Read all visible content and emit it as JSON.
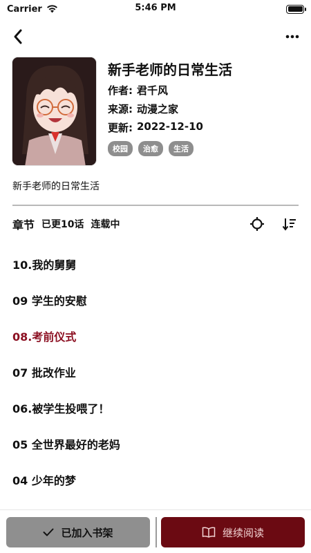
{
  "status_bar": {
    "carrier": "Carrier",
    "time": "5:46 PM"
  },
  "nav": {
    "back_icon": "chevron-left-icon",
    "more_icon": "more-dots-icon"
  },
  "comic": {
    "title": "新手老师的日常生活",
    "author_label": "作者:",
    "author": "君千风",
    "source_label": "来源:",
    "source": "动漫之家",
    "updated_label": "更新:",
    "updated": "2022-12-10",
    "tags": [
      "校园",
      "治愈",
      "生活"
    ],
    "description": "新手老师的日常生活"
  },
  "chapters_header": {
    "title": "章节",
    "count": "已更10话",
    "status": "连载中"
  },
  "chapters": [
    {
      "label": "10.我的舅舅",
      "active": false
    },
    {
      "label": "09 学生的安慰",
      "active": false
    },
    {
      "label": "08.考前仪式",
      "active": true
    },
    {
      "label": "07 批改作业",
      "active": false
    },
    {
      "label": "06.被学生投喂了！",
      "active": false
    },
    {
      "label": "05 全世界最好的老妈",
      "active": false
    },
    {
      "label": "04 少年的梦",
      "active": false
    }
  ],
  "bottom": {
    "shelf_label": "已加入书架",
    "read_label": "继续阅读"
  },
  "colors": {
    "accent": "#6b0a12",
    "active_chapter": "#8c1022",
    "tag_bg": "#8e8e8e",
    "shelf_bg": "#8f8f8f"
  }
}
